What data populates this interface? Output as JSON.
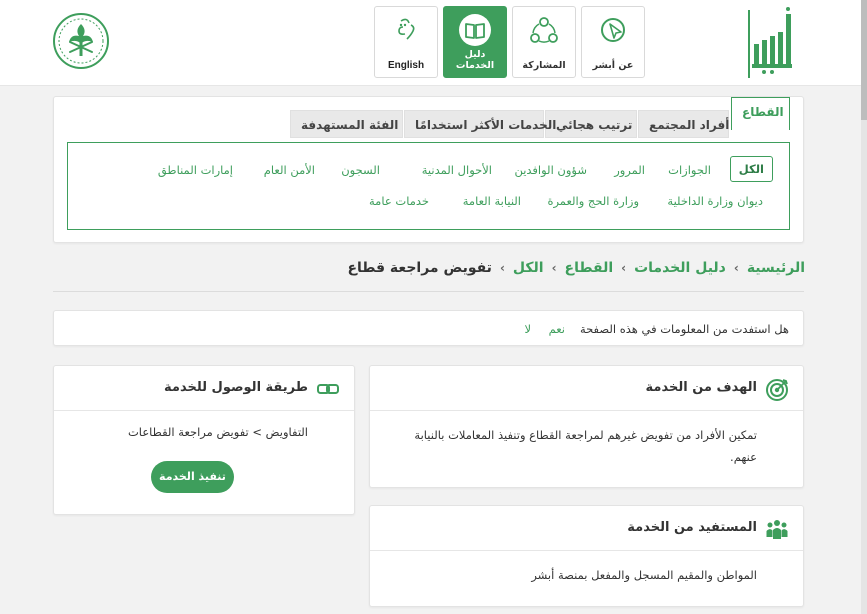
{
  "header": {
    "nav": [
      {
        "label": "عن أبشر",
        "icon": "cursor-circle-icon"
      },
      {
        "label": "المشاركة",
        "icon": "share-nodes-icon"
      },
      {
        "label": "دليل الخدمات",
        "icon": "book-icon",
        "active": true
      },
      {
        "label": "English",
        "icon": "language-icon"
      }
    ],
    "logo_text": "أبشر"
  },
  "tabs": [
    "القطاع",
    "أفراد المجتمع",
    "ترتيب هجائي",
    "الخدمات الأكثر استخدامًا",
    "الفئة المستهدفة"
  ],
  "filters": {
    "row1": [
      "الكل",
      "الجوازات",
      "المرور",
      "شؤون الوافدين",
      "الأحوال المدنية",
      "السجون",
      "الأمن العام",
      "إمارات المناطق"
    ],
    "row2": [
      "ديوان وزارة الداخلية",
      "وزارة الحج والعمرة",
      "النيابة العامة",
      "خدمات عامة"
    ]
  },
  "breadcrumb": {
    "items": [
      "الرئيسية",
      "دليل الخدمات",
      "القطاع",
      "الكل"
    ],
    "current": "تفويض مراجعة قطاع",
    "separator": "›"
  },
  "feedback": {
    "question": "هل استفدت من المعلومات في هذه الصفحة",
    "yes": "نعم",
    "no": "لا"
  },
  "goal": {
    "title": "الهدف من الخدمة",
    "text": "تمكين الأفراد من تفويض غيرهم لمراجعة القطاع وتنفيذ المعاملات بالنيابة عنهم."
  },
  "beneficiary": {
    "title": "المستفيد من الخدمة",
    "text": "المواطن والمقيم المسجل والمفعل بمنصة أبشر"
  },
  "access": {
    "title": "طريقة الوصول للخدمة",
    "path": "التفاويض > تفويض مراجعة القطاعات",
    "button": "تنفيذ الخدمة"
  },
  "colors": {
    "primary": "#3e9e5c",
    "background": "#f2f2f2"
  }
}
